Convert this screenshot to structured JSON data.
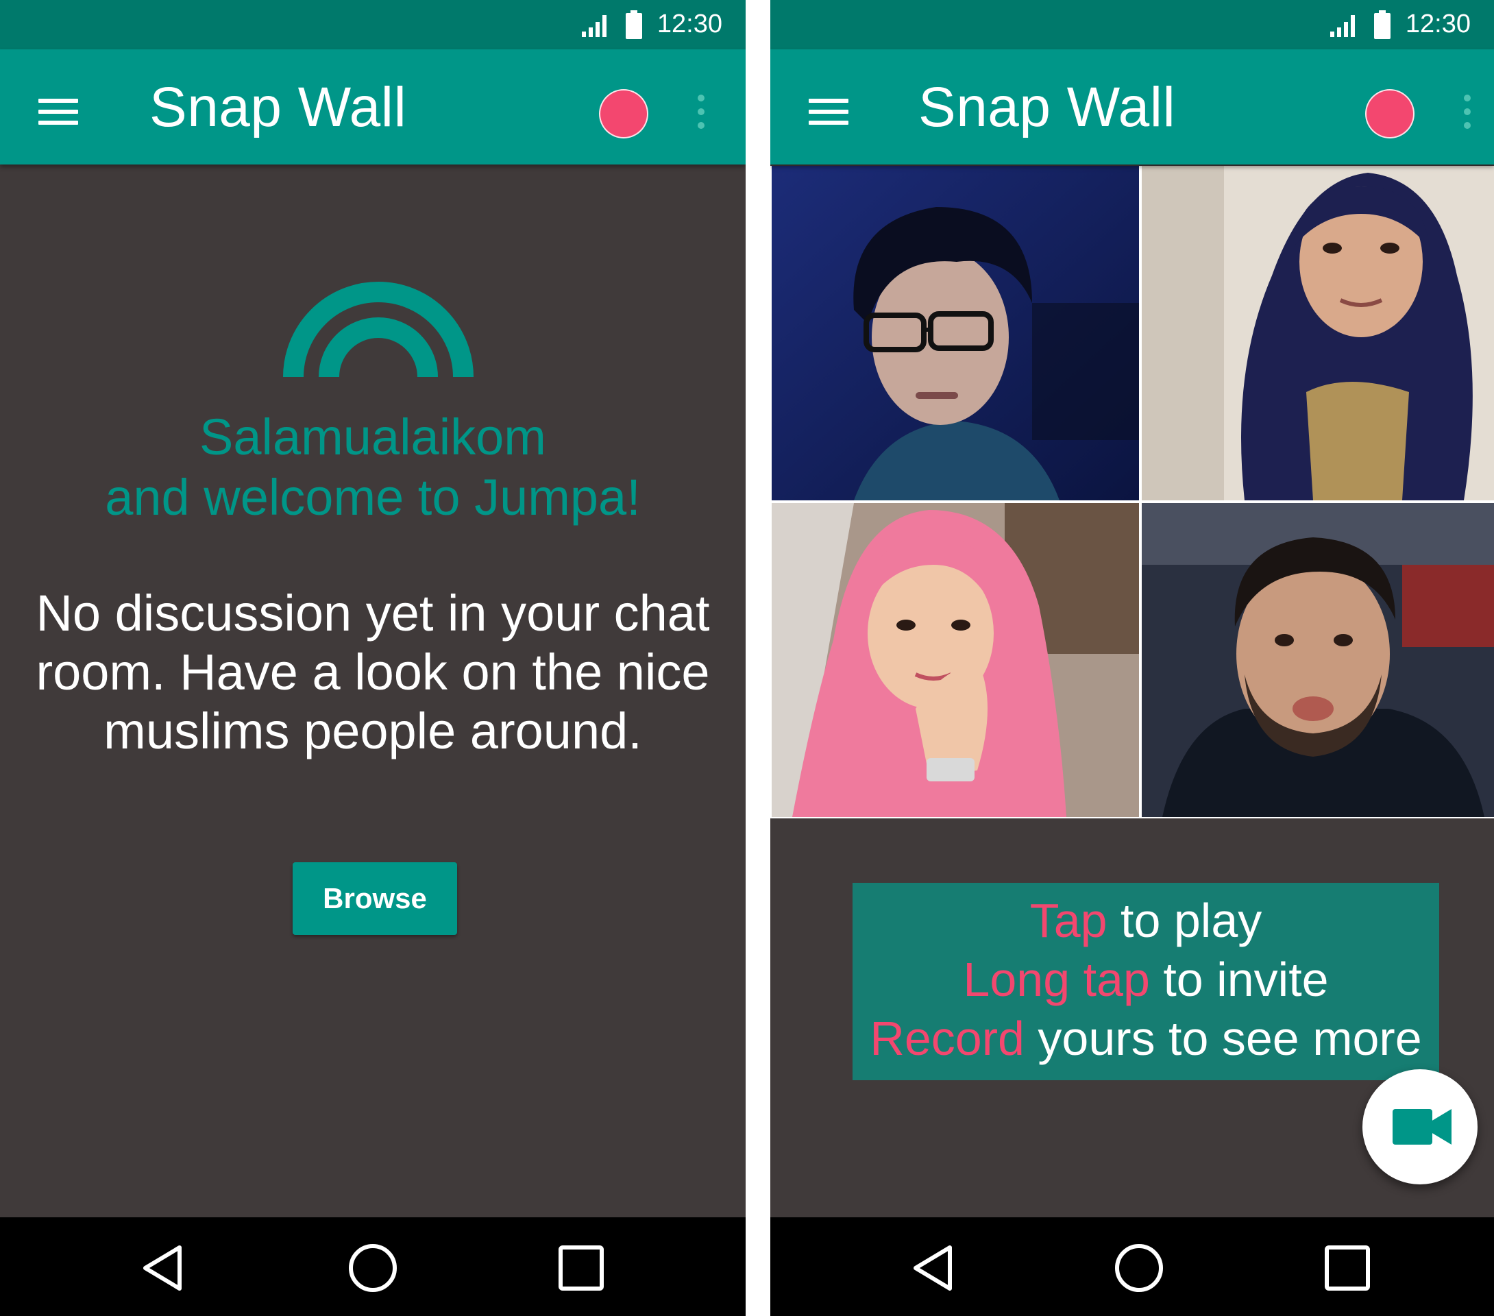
{
  "colors": {
    "primary": "#009688",
    "primary_dark": "#00796b",
    "accent": "#f3476f",
    "background": "#403a3a",
    "hint_background": "#167d72"
  },
  "status_bar": {
    "time": "12:30"
  },
  "left_screen": {
    "toolbar": {
      "title": "Snap Wall"
    },
    "welcome": {
      "line1": "Salamualaikom",
      "line2": "and welcome to Jumpa!"
    },
    "empty_message": {
      "line1": "No discussion yet in your chat",
      "line2": "room. Have a look on the nice",
      "line3": "muslims people around."
    },
    "browse_label": "Browse"
  },
  "right_screen": {
    "toolbar": {
      "title": "Snap Wall"
    },
    "snaps": [
      {
        "subject": "young man with glasses"
      },
      {
        "subject": "woman in navy hijab"
      },
      {
        "subject": "woman in pink hijab"
      },
      {
        "subject": "man in dark jacket"
      }
    ],
    "hints": [
      {
        "accent": "Tap",
        "text": " to play"
      },
      {
        "accent": "Long tap",
        "text": " to invite"
      },
      {
        "accent": "Record",
        "text": " yours to see more"
      }
    ],
    "fab_icon": "videocam-icon"
  },
  "nav_icons": [
    "back-icon",
    "home-icon",
    "recents-icon"
  ]
}
